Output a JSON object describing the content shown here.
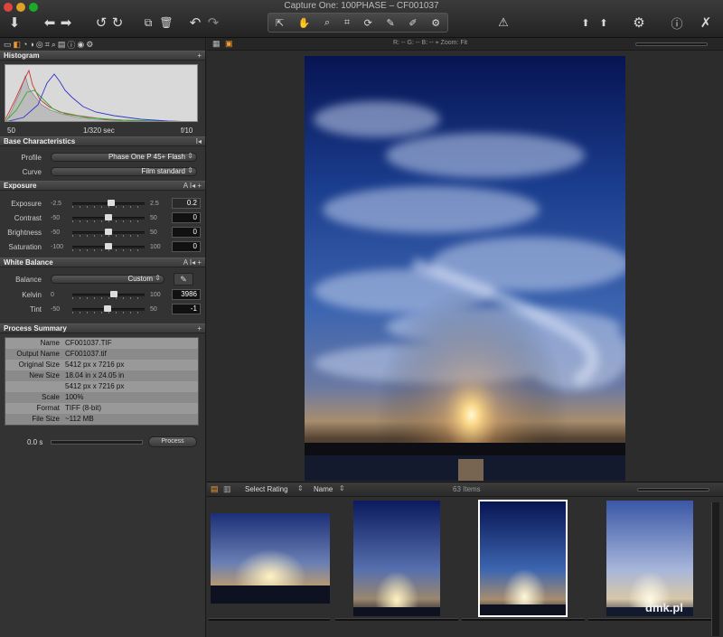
{
  "window": {
    "title": "Capture One: 100PHASE – CF001037"
  },
  "toolbar": {
    "icons": [
      "import-icon",
      "back-icon",
      "forward-icon",
      "rotate-left-icon",
      "rotate-right-icon",
      "copy-icon",
      "trash-icon",
      "undo-icon",
      "redo-icon",
      "pan-icon",
      "hand-icon",
      "zoom-icon",
      "crop-icon",
      "rotate-icon",
      "picker-icon",
      "brush-icon",
      "stamp-icon",
      "warning-icon",
      "export-icon",
      "settings-icon",
      "info-icon",
      "tools-icon"
    ]
  },
  "histogram": {
    "title": "Histogram",
    "iso": "50",
    "shutter": "1/320 sec",
    "aperture": "f/10"
  },
  "base": {
    "title": "Base Characteristics",
    "profile_label": "Profile",
    "profile_value": "Phase One P 45+ Flash",
    "curve_label": "Curve",
    "curve_value": "Film standard"
  },
  "exposure": {
    "title": "Exposure",
    "rows": [
      {
        "label": "Exposure",
        "min": "-2.5",
        "max": "2.5",
        "value": "0.2",
        "level": 0.54
      },
      {
        "label": "Contrast",
        "min": "-50",
        "max": "50",
        "value": "0",
        "level": 0.5
      },
      {
        "label": "Brightness",
        "min": "-50",
        "max": "50",
        "value": "0",
        "level": 0.5
      },
      {
        "label": "Saturation",
        "min": "-100",
        "max": "100",
        "value": "0",
        "level": 0.5
      }
    ]
  },
  "white_balance": {
    "title": "White Balance",
    "balance_label": "Balance",
    "balance_value": "Custom",
    "rows": [
      {
        "label": "Kelvin",
        "min": "0",
        "max": "100",
        "value": "3986",
        "level": 0.58
      },
      {
        "label": "Tint",
        "min": "-50",
        "max": "50",
        "value": "-1",
        "level": 0.49
      }
    ]
  },
  "process_summary": {
    "title": "Process Summary",
    "rows": [
      {
        "key": "Name",
        "value": "CF001037.TIF"
      },
      {
        "key": "Output Name",
        "value": "CF001037.tif"
      },
      {
        "key": "Original Size",
        "value": "5412 px x 7216 px"
      },
      {
        "key": "New Size",
        "value": "18.04 in x 24.05 in"
      },
      {
        "key": "",
        "value": "5412 px x 7216 px"
      },
      {
        "key": "Scale",
        "value": "100%"
      },
      {
        "key": "Format",
        "value": "TIFF (8-bit)"
      },
      {
        "key": "File Size",
        "value": "~112 MB"
      }
    ],
    "time": "0.0 s",
    "process_button": "Process"
  },
  "viewer": {
    "readout": "R: --  G: --  B: --   ⌖  Zoom: Fit"
  },
  "browser": {
    "rating_select": "Select Rating",
    "sort_select": "Name",
    "count": "63 Items"
  },
  "watermark": "dmk.pl"
}
